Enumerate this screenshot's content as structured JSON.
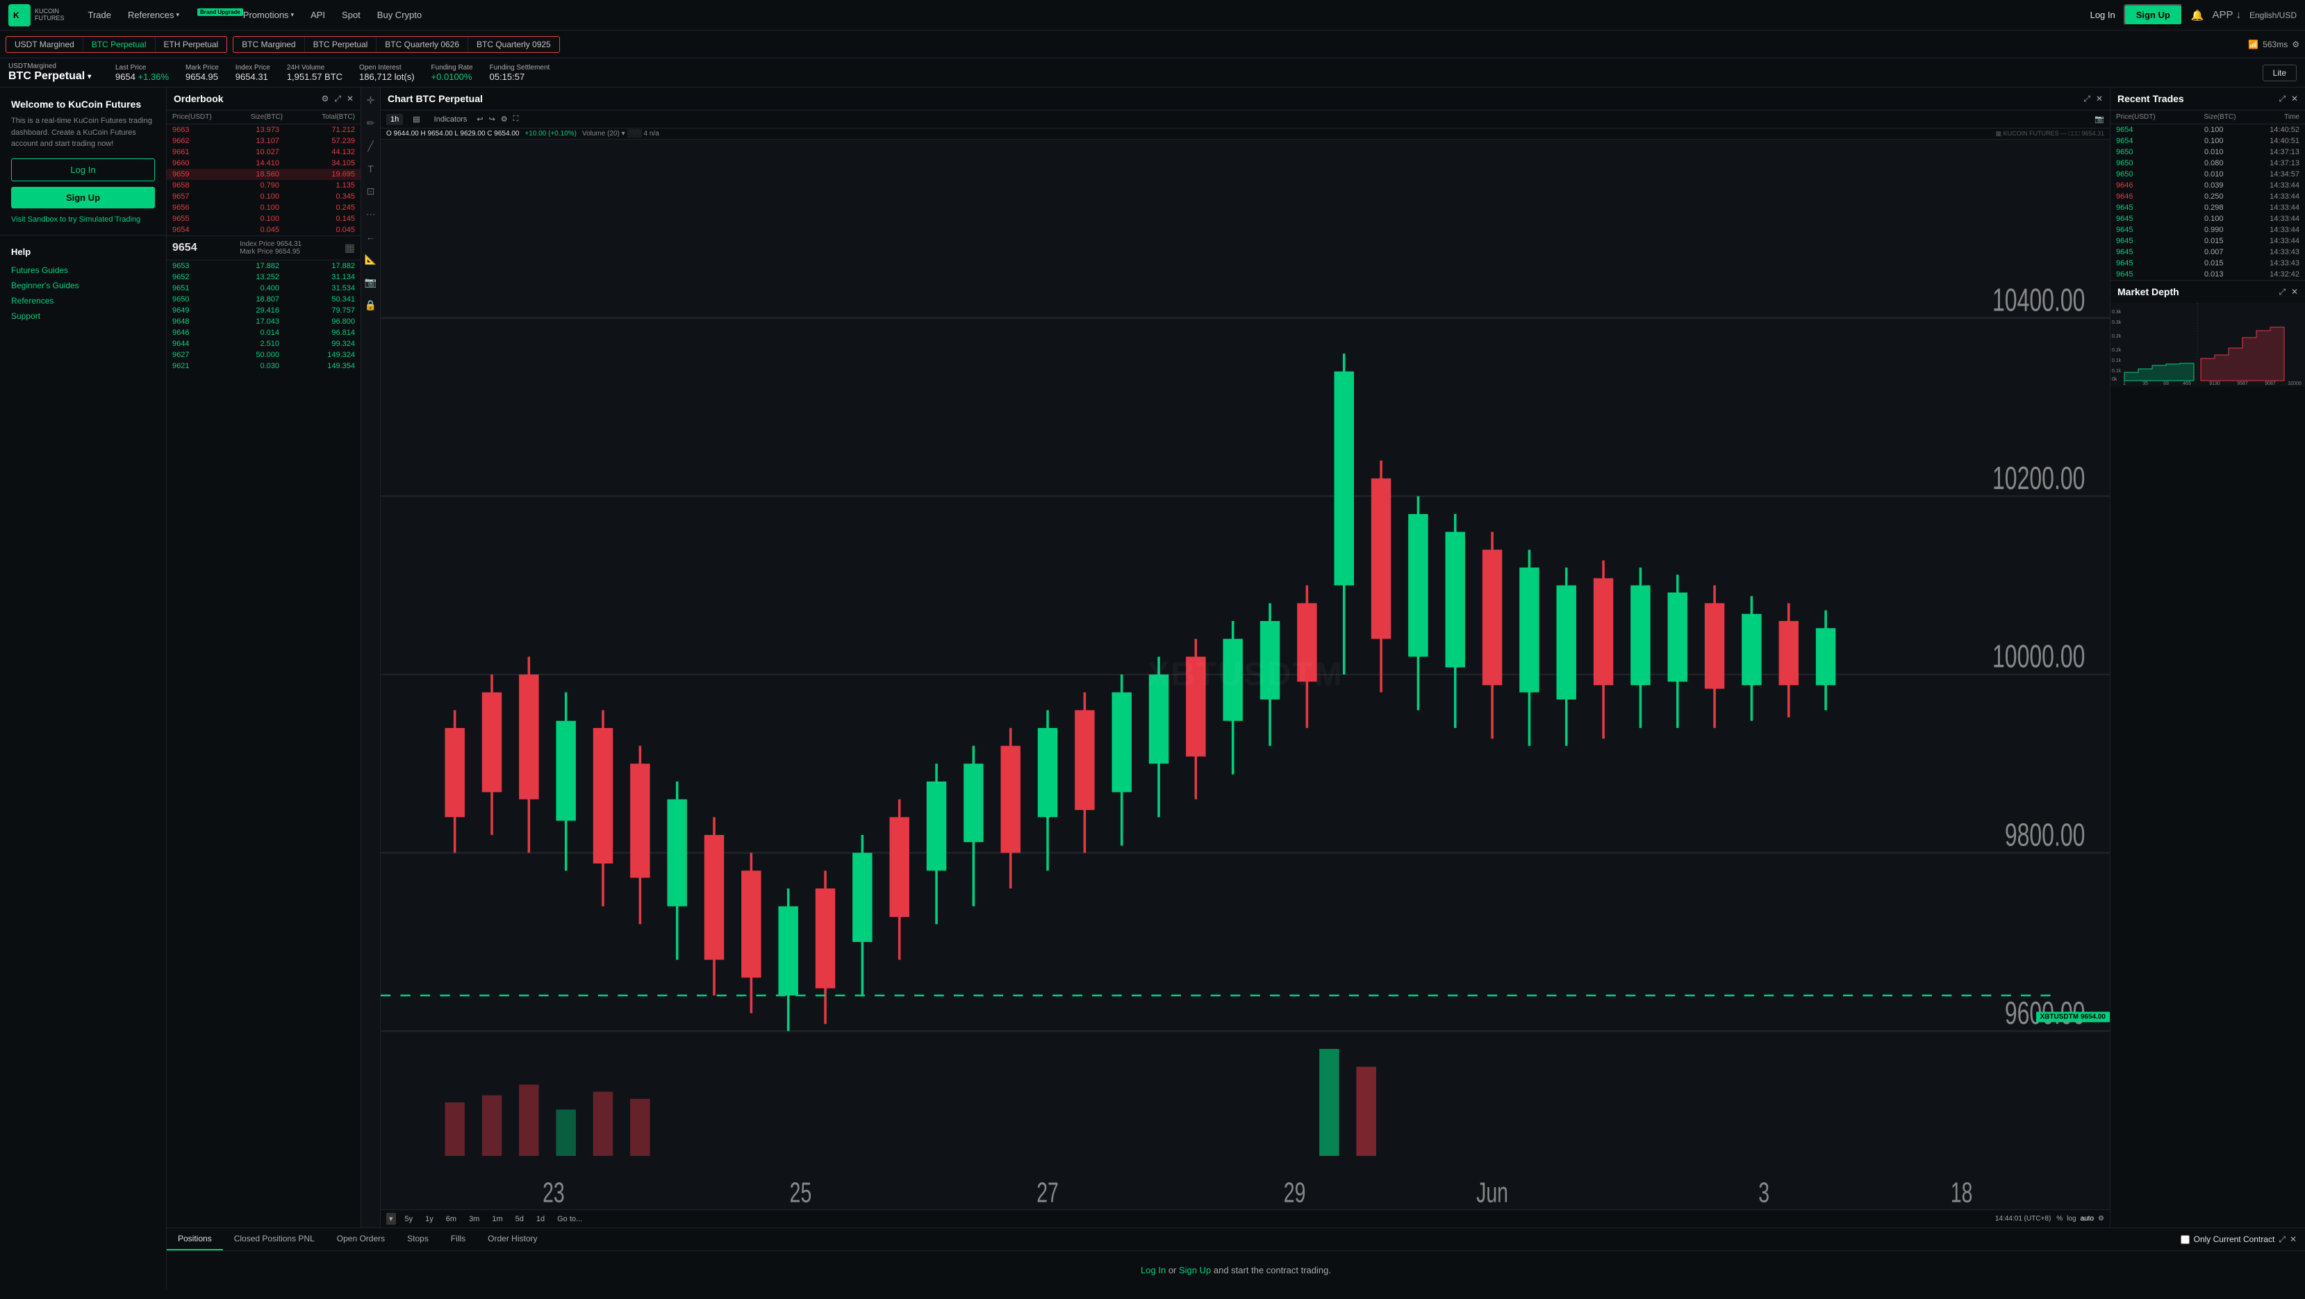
{
  "navbar": {
    "logo_text": "KUCOIN",
    "logo_sub": "FUTURES",
    "links": [
      {
        "label": "Trade",
        "has_arrow": false
      },
      {
        "label": "References",
        "has_arrow": true
      },
      {
        "label": "Promotions",
        "has_arrow": true,
        "badge": "Brand Upgrade"
      },
      {
        "label": "API",
        "has_arrow": false
      },
      {
        "label": "Spot",
        "has_arrow": false
      },
      {
        "label": "Buy Crypto",
        "has_arrow": false
      }
    ],
    "login": "Log In",
    "signup": "Sign Up",
    "lang": "English/USD"
  },
  "tabs": {
    "group1": [
      {
        "label": "USDT Margined",
        "active": false
      },
      {
        "label": "BTC Perpetual",
        "active": true
      },
      {
        "label": "ETH Perpetual",
        "active": false
      }
    ],
    "group2": [
      {
        "label": "BTC Margined",
        "active": false
      },
      {
        "label": "BTC Perpetual",
        "active": false
      },
      {
        "label": "BTC Quarterly 0626",
        "active": false
      },
      {
        "label": "BTC Quarterly 0925",
        "active": false
      }
    ],
    "wifi": "563ms"
  },
  "price_header": {
    "instrument_label": "USDTMargined",
    "instrument_name": "BTC Perpetual",
    "last_price_label": "Last Price",
    "last_price": "9654",
    "last_price_change": "+1.36%",
    "mark_price_label": "Mark Price",
    "mark_price": "9654.95",
    "index_price_label": "Index Price",
    "index_price": "9654.31",
    "volume_label": "24H Volume",
    "volume": "1,951.57 BTC",
    "open_interest_label": "Open Interest",
    "open_interest": "186,712 lot(s)",
    "funding_rate_label": "Funding Rate",
    "funding_rate": "+0.0100%",
    "funding_settlement_label": "Funding Settlement",
    "funding_settlement": "05:15:57",
    "lite_btn": "Lite"
  },
  "orderbook": {
    "title": "Orderbook",
    "col_price": "Price(USDT)",
    "col_size": "Size(BTC)",
    "col_total": "Total(BTC)",
    "sells": [
      {
        "price": "9663",
        "size": "13.973",
        "total": "71.212"
      },
      {
        "price": "9662",
        "size": "13.107",
        "total": "57.239"
      },
      {
        "price": "9661",
        "size": "10.027",
        "total": "44.132"
      },
      {
        "price": "9660",
        "size": "14.410",
        "total": "34.105"
      },
      {
        "price": "9659",
        "size": "18.560",
        "total": "19.695",
        "highlight": true
      },
      {
        "price": "9658",
        "size": "0.790",
        "total": "1.135"
      },
      {
        "price": "9657",
        "size": "0.100",
        "total": "0.345"
      },
      {
        "price": "9656",
        "size": "0.100",
        "total": "0.245"
      },
      {
        "price": "9655",
        "size": "0.100",
        "total": "0.145"
      },
      {
        "price": "9654",
        "size": "0.045",
        "total": "0.045"
      }
    ],
    "mid_price": "9654",
    "mid_index_label": "Index Price",
    "mid_index": "9654.31",
    "mid_mark_label": "Mark Price",
    "mid_mark": "9654.95",
    "buys": [
      {
        "price": "9653",
        "size": "17.882",
        "total": "17.882"
      },
      {
        "price": "9652",
        "size": "13.252",
        "total": "31.134"
      },
      {
        "price": "9651",
        "size": "0.400",
        "total": "31.534"
      },
      {
        "price": "9650",
        "size": "18.807",
        "total": "50.341"
      },
      {
        "price": "9649",
        "size": "29.416",
        "total": "79.757"
      },
      {
        "price": "9648",
        "size": "17.043",
        "total": "96.800"
      },
      {
        "price": "9646",
        "size": "0.014",
        "total": "96.814"
      },
      {
        "price": "9644",
        "size": "2.510",
        "total": "99.324"
      },
      {
        "price": "9627",
        "size": "50.000",
        "total": "149.324"
      },
      {
        "price": "9621",
        "size": "0.030",
        "total": "149.354"
      }
    ]
  },
  "chart": {
    "title": "Chart BTC Perpetual",
    "timeframes": [
      "5y",
      "1y",
      "6m",
      "3m",
      "1m",
      "5d",
      "1d",
      "Go to..."
    ],
    "current_tf": "1h",
    "indicators_label": "Indicators",
    "price_info": {
      "open": "O 9644.00",
      "high": "H 9654.00",
      "low": "L 9629.00",
      "close": "C 9654.00",
      "change": "+10.00 (+0.10%)"
    },
    "volume_label": "Volume (20)",
    "price_tag": "9654.00",
    "timestamp": "14:44:01 (UTC+8)",
    "watermark": "XBTUSDTM",
    "current_price": "9654.00",
    "label": "XBTUSDTM",
    "exchange": "KUCOIN FUTURES"
  },
  "recent_trades": {
    "title": "Recent Trades",
    "col_price": "Price(USDT)",
    "col_size": "Size(BTC)",
    "col_time": "Time",
    "trades": [
      {
        "price": "9654",
        "size": "0.100",
        "time": "14:40:52",
        "dir": "up"
      },
      {
        "price": "9654",
        "size": "0.100",
        "time": "14:40:51",
        "dir": "up"
      },
      {
        "price": "9650",
        "size": "0.010",
        "time": "14:37:13",
        "dir": "up"
      },
      {
        "price": "9650",
        "size": "0.080",
        "time": "14:37:13",
        "dir": "up"
      },
      {
        "price": "9650",
        "size": "0.010",
        "time": "14:34:57",
        "dir": "up"
      },
      {
        "price": "9646",
        "size": "0.039",
        "time": "14:33:44",
        "dir": "down"
      },
      {
        "price": "9646",
        "size": "0.250",
        "time": "14:33:44",
        "dir": "down"
      },
      {
        "price": "9645",
        "size": "0.298",
        "time": "14:33:44",
        "dir": "up"
      },
      {
        "price": "9645",
        "size": "0.100",
        "time": "14:33:44",
        "dir": "up"
      },
      {
        "price": "9645",
        "size": "0.990",
        "time": "14:33:44",
        "dir": "up"
      },
      {
        "price": "9645",
        "size": "0.015",
        "time": "14:33:44",
        "dir": "up"
      },
      {
        "price": "9645",
        "size": "0.007",
        "time": "14:33:43",
        "dir": "up"
      },
      {
        "price": "9645",
        "size": "0.015",
        "time": "14:33:43",
        "dir": "up"
      },
      {
        "price": "9645",
        "size": "0.013",
        "time": "14:32:42",
        "dir": "up"
      }
    ]
  },
  "market_depth": {
    "title": "Market Depth",
    "x_labels": [
      "1",
      "35",
      "69",
      "465",
      "9130",
      "9587",
      "9087",
      "32000"
    ],
    "y_labels": [
      "0.3k",
      "0.3k",
      "0.2k",
      "0.2k",
      "0.1k",
      "0.1k",
      "0k"
    ]
  },
  "bottom_tabs": {
    "tabs": [
      "Positions",
      "Closed Positions PNL",
      "Open Orders",
      "Stops",
      "Fills",
      "Order History"
    ],
    "active": "Positions",
    "only_current": "Only Current Contract",
    "empty_text_login": "Log In",
    "empty_text_mid": " or ",
    "empty_text_signup": "Sign Up",
    "empty_text_end": " and start the contract trading."
  },
  "welcome": {
    "title": "Welcome to KuCoin Futures",
    "text": "This is a real-time KuCoin Futures trading dashboard. Create a KuCoin Futures account and start trading now!",
    "login_btn": "Log In",
    "signup_btn": "Sign Up",
    "sandbox_text": "Visit Sandbox to try Simulated Trading"
  },
  "help": {
    "title": "Help",
    "links": [
      "Futures Guides",
      "Beginner's Guides",
      "References",
      "Support"
    ]
  }
}
